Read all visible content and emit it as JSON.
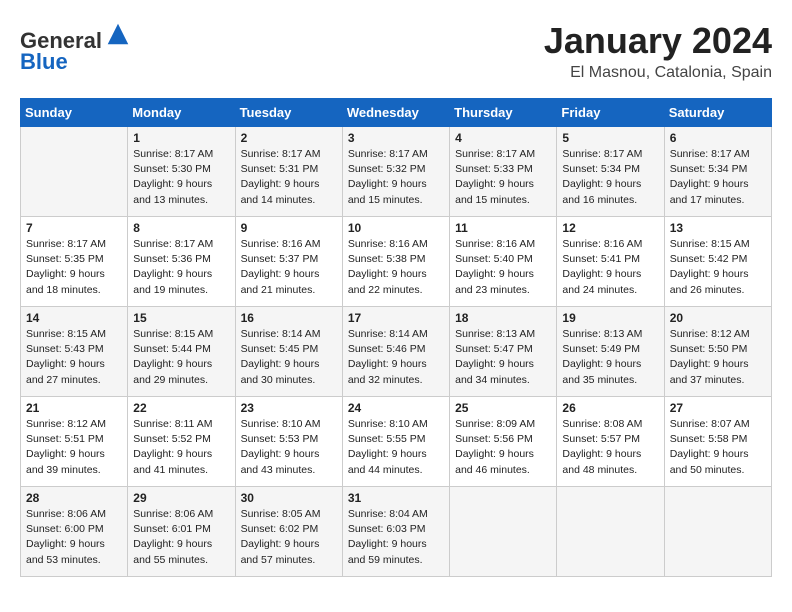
{
  "header": {
    "logo_line1": "General",
    "logo_line2": "Blue",
    "month": "January 2024",
    "location": "El Masnou, Catalonia, Spain"
  },
  "days_of_week": [
    "Sunday",
    "Monday",
    "Tuesday",
    "Wednesday",
    "Thursday",
    "Friday",
    "Saturday"
  ],
  "weeks": [
    [
      {
        "day": "",
        "info": ""
      },
      {
        "day": "1",
        "info": "Sunrise: 8:17 AM\nSunset: 5:30 PM\nDaylight: 9 hours\nand 13 minutes."
      },
      {
        "day": "2",
        "info": "Sunrise: 8:17 AM\nSunset: 5:31 PM\nDaylight: 9 hours\nand 14 minutes."
      },
      {
        "day": "3",
        "info": "Sunrise: 8:17 AM\nSunset: 5:32 PM\nDaylight: 9 hours\nand 15 minutes."
      },
      {
        "day": "4",
        "info": "Sunrise: 8:17 AM\nSunset: 5:33 PM\nDaylight: 9 hours\nand 15 minutes."
      },
      {
        "day": "5",
        "info": "Sunrise: 8:17 AM\nSunset: 5:34 PM\nDaylight: 9 hours\nand 16 minutes."
      },
      {
        "day": "6",
        "info": "Sunrise: 8:17 AM\nSunset: 5:34 PM\nDaylight: 9 hours\nand 17 minutes."
      }
    ],
    [
      {
        "day": "7",
        "info": "Sunrise: 8:17 AM\nSunset: 5:35 PM\nDaylight: 9 hours\nand 18 minutes."
      },
      {
        "day": "8",
        "info": "Sunrise: 8:17 AM\nSunset: 5:36 PM\nDaylight: 9 hours\nand 19 minutes."
      },
      {
        "day": "9",
        "info": "Sunrise: 8:16 AM\nSunset: 5:37 PM\nDaylight: 9 hours\nand 21 minutes."
      },
      {
        "day": "10",
        "info": "Sunrise: 8:16 AM\nSunset: 5:38 PM\nDaylight: 9 hours\nand 22 minutes."
      },
      {
        "day": "11",
        "info": "Sunrise: 8:16 AM\nSunset: 5:40 PM\nDaylight: 9 hours\nand 23 minutes."
      },
      {
        "day": "12",
        "info": "Sunrise: 8:16 AM\nSunset: 5:41 PM\nDaylight: 9 hours\nand 24 minutes."
      },
      {
        "day": "13",
        "info": "Sunrise: 8:15 AM\nSunset: 5:42 PM\nDaylight: 9 hours\nand 26 minutes."
      }
    ],
    [
      {
        "day": "14",
        "info": "Sunrise: 8:15 AM\nSunset: 5:43 PM\nDaylight: 9 hours\nand 27 minutes."
      },
      {
        "day": "15",
        "info": "Sunrise: 8:15 AM\nSunset: 5:44 PM\nDaylight: 9 hours\nand 29 minutes."
      },
      {
        "day": "16",
        "info": "Sunrise: 8:14 AM\nSunset: 5:45 PM\nDaylight: 9 hours\nand 30 minutes."
      },
      {
        "day": "17",
        "info": "Sunrise: 8:14 AM\nSunset: 5:46 PM\nDaylight: 9 hours\nand 32 minutes."
      },
      {
        "day": "18",
        "info": "Sunrise: 8:13 AM\nSunset: 5:47 PM\nDaylight: 9 hours\nand 34 minutes."
      },
      {
        "day": "19",
        "info": "Sunrise: 8:13 AM\nSunset: 5:49 PM\nDaylight: 9 hours\nand 35 minutes."
      },
      {
        "day": "20",
        "info": "Sunrise: 8:12 AM\nSunset: 5:50 PM\nDaylight: 9 hours\nand 37 minutes."
      }
    ],
    [
      {
        "day": "21",
        "info": "Sunrise: 8:12 AM\nSunset: 5:51 PM\nDaylight: 9 hours\nand 39 minutes."
      },
      {
        "day": "22",
        "info": "Sunrise: 8:11 AM\nSunset: 5:52 PM\nDaylight: 9 hours\nand 41 minutes."
      },
      {
        "day": "23",
        "info": "Sunrise: 8:10 AM\nSunset: 5:53 PM\nDaylight: 9 hours\nand 43 minutes."
      },
      {
        "day": "24",
        "info": "Sunrise: 8:10 AM\nSunset: 5:55 PM\nDaylight: 9 hours\nand 44 minutes."
      },
      {
        "day": "25",
        "info": "Sunrise: 8:09 AM\nSunset: 5:56 PM\nDaylight: 9 hours\nand 46 minutes."
      },
      {
        "day": "26",
        "info": "Sunrise: 8:08 AM\nSunset: 5:57 PM\nDaylight: 9 hours\nand 48 minutes."
      },
      {
        "day": "27",
        "info": "Sunrise: 8:07 AM\nSunset: 5:58 PM\nDaylight: 9 hours\nand 50 minutes."
      }
    ],
    [
      {
        "day": "28",
        "info": "Sunrise: 8:06 AM\nSunset: 6:00 PM\nDaylight: 9 hours\nand 53 minutes."
      },
      {
        "day": "29",
        "info": "Sunrise: 8:06 AM\nSunset: 6:01 PM\nDaylight: 9 hours\nand 55 minutes."
      },
      {
        "day": "30",
        "info": "Sunrise: 8:05 AM\nSunset: 6:02 PM\nDaylight: 9 hours\nand 57 minutes."
      },
      {
        "day": "31",
        "info": "Sunrise: 8:04 AM\nSunset: 6:03 PM\nDaylight: 9 hours\nand 59 minutes."
      },
      {
        "day": "",
        "info": ""
      },
      {
        "day": "",
        "info": ""
      },
      {
        "day": "",
        "info": ""
      }
    ]
  ]
}
